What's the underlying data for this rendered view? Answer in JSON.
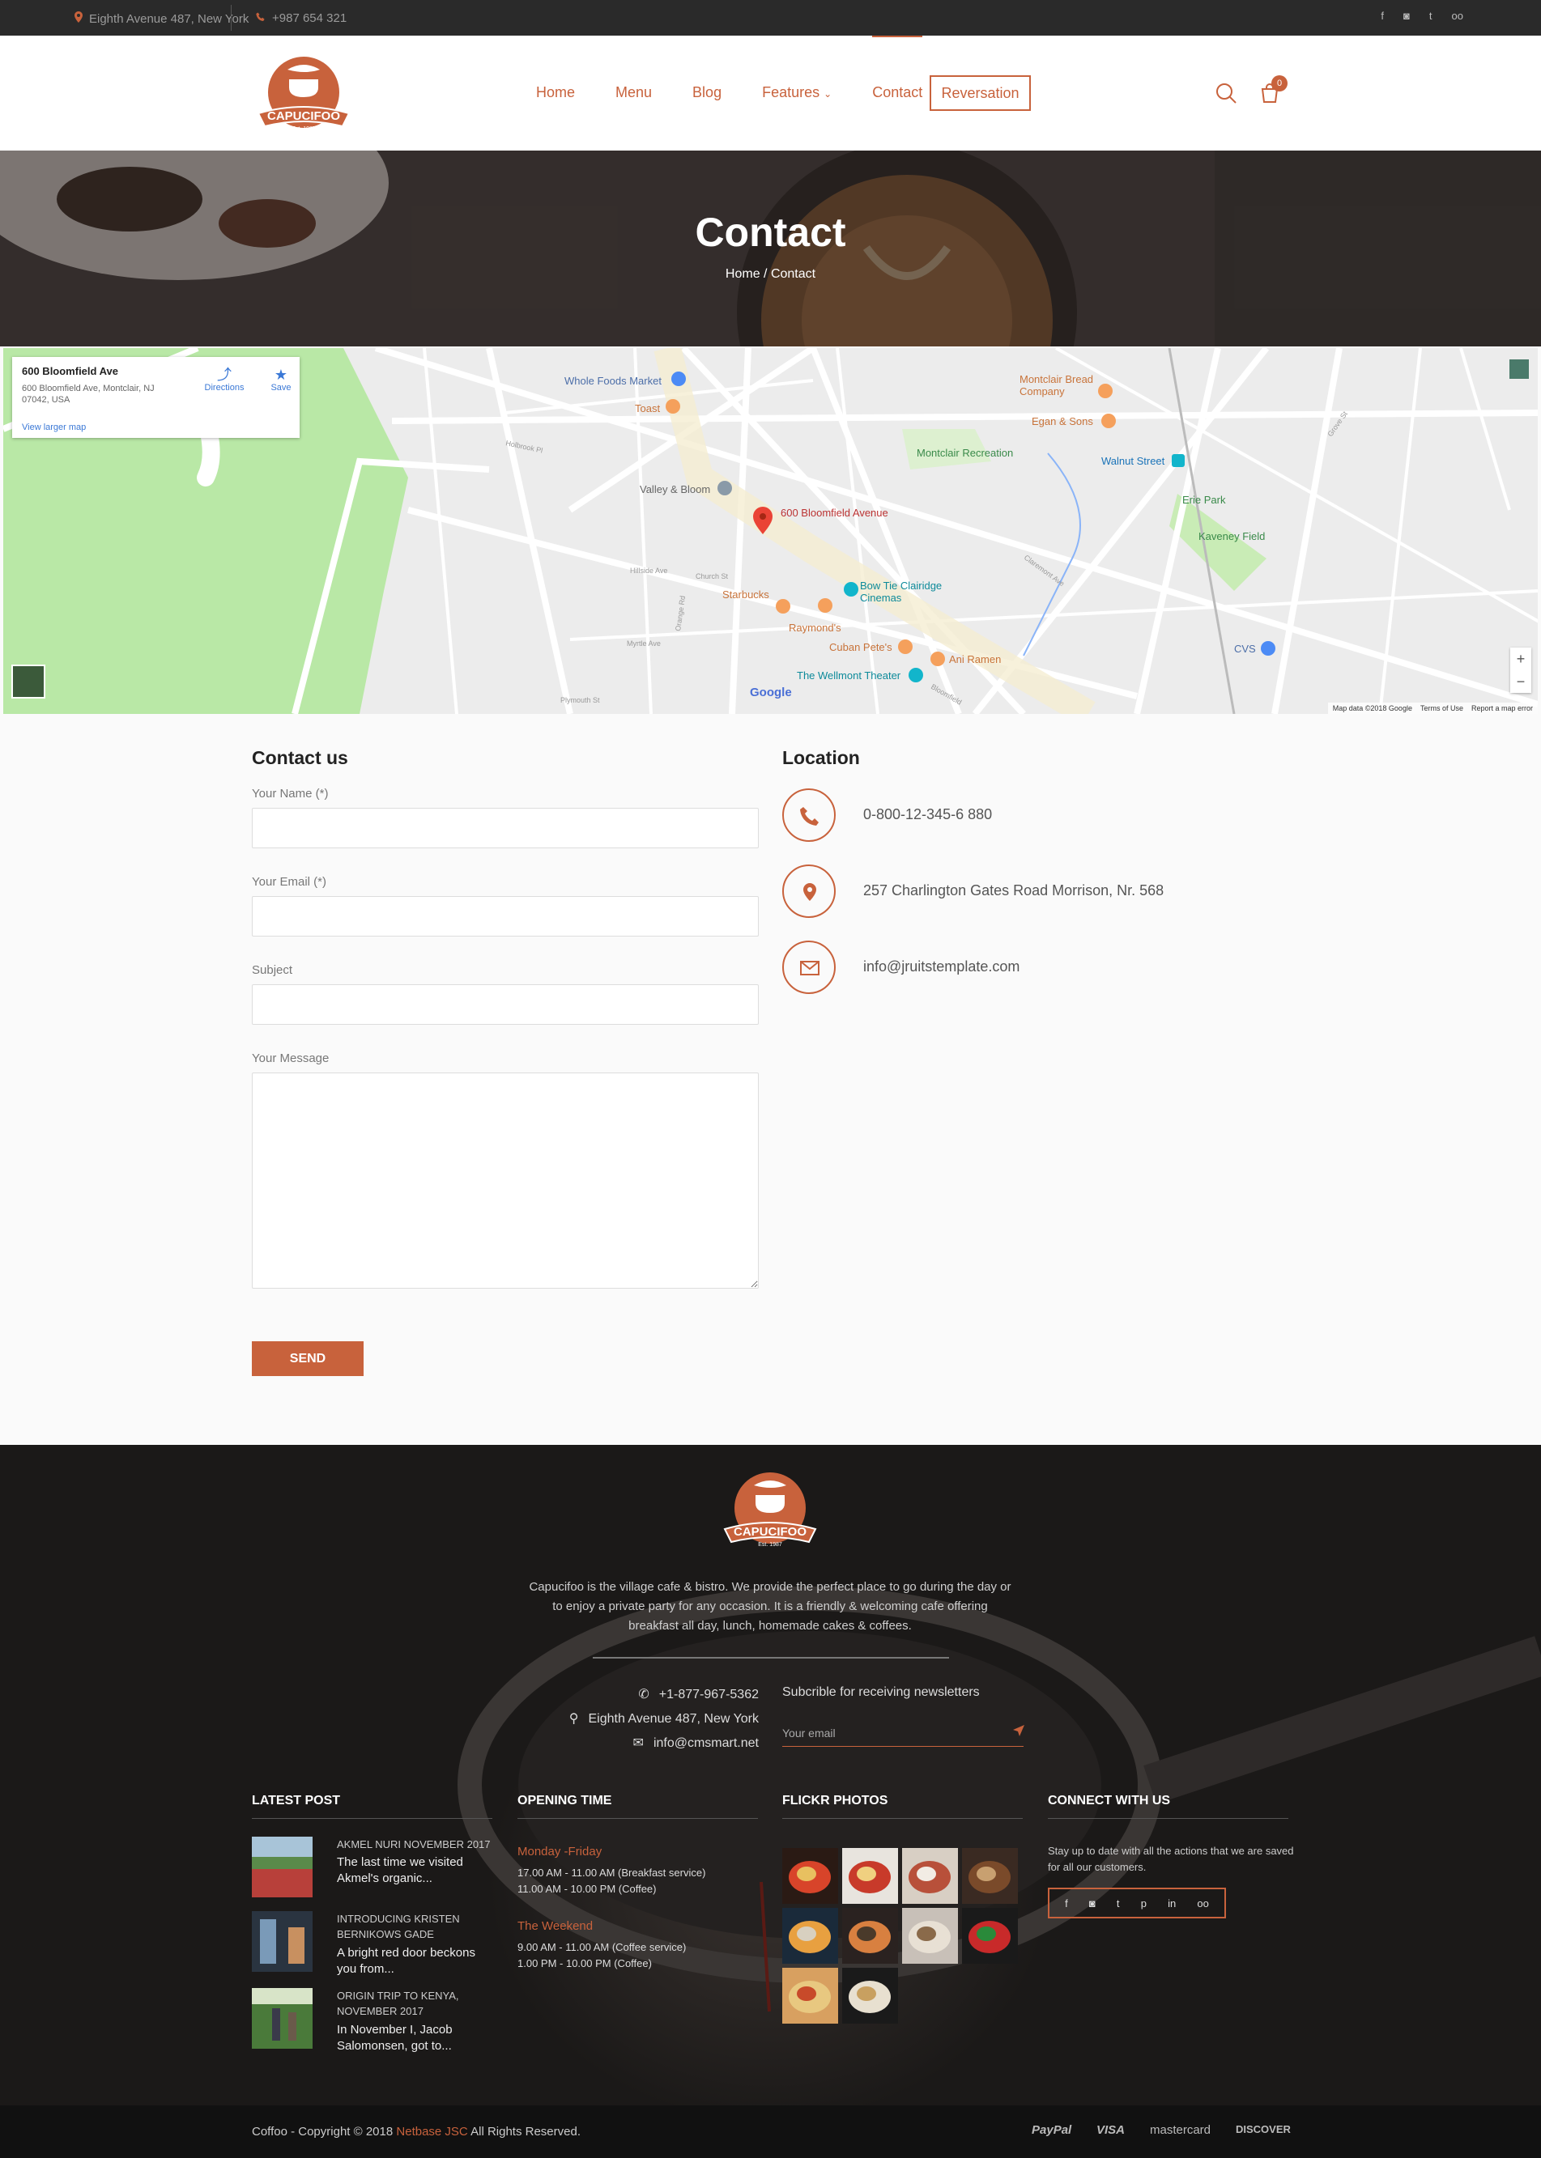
{
  "topbar": {
    "address": "Eighth Avenue 487, New York",
    "phone": "+987 654 321",
    "socials": [
      "facebook-icon",
      "instagram-icon",
      "twitter-icon",
      "tripadvisor-icon"
    ]
  },
  "header": {
    "logo_text": "CAPUCIFOO",
    "logo_sub": "Est. 1987",
    "nav": [
      "Home",
      "Menu",
      "Blog",
      "Features",
      "Contact"
    ],
    "reserve_label": "Reversation",
    "cart_count": "0"
  },
  "hero": {
    "title": "Contact",
    "breadcrumb": "Home / Contact"
  },
  "map": {
    "card_title": "600 Bloomfield Ave",
    "card_address": "600 Bloomfield Ave, Montclair, NJ 07042, USA",
    "card_link": "View larger map",
    "directions": "Directions",
    "save": "Save",
    "pin_label": "600 Bloomfield Avenue",
    "places": [
      "Whole Foods Market",
      "Toast",
      "Valley & Bloom",
      "Starbucks",
      "Raymond's",
      "Bow Tie Clairidge Cinemas",
      "Cuban Pete's",
      "Ani Ramen",
      "The Wellmont Theater",
      "Montclair Bread Company",
      "Egan & Sons",
      "Montclair Recreation",
      "Walnut Street",
      "Erie Park",
      "Kaveney Field",
      "CVS"
    ],
    "streets": [
      "Claremont Ave",
      "Grove St",
      "Orange Rd",
      "Bloomfield",
      "Hillside Ave",
      "Church St",
      "Plymouth St"
    ],
    "footer": [
      "Map data ©2018 Google",
      "Terms of Use",
      "Report a map error"
    ],
    "google": "Google"
  },
  "contact_form": {
    "title": "Contact us",
    "name_label": "Your Name (*)",
    "email_label": "Your Email (*)",
    "subject_label": "Subject",
    "message_label": "Your Message",
    "send_label": "SEND"
  },
  "location": {
    "title": "Location",
    "phone": "0-800-12-345-6 880",
    "address": "257 Charlington Gates Road Morrison, Nr. 568",
    "email": "info@jruitstemplate.com"
  },
  "footer": {
    "logo_text": "CAPUCIFOO",
    "logo_sub": "Est. 1987",
    "about": "Capucifoo is the village cafe & bistro. We provide the perfect place to go during the day or to enjoy a private party for any occasion. It is a friendly & welcoming cafe offering breakfast all day, lunch, homemade cakes & coffees.",
    "phone": "+1-877-967-5362",
    "address": "Eighth Avenue 487, New York",
    "email": "info@cmsmart.net",
    "newsletter_title": "Subcrible for receiving newsletters",
    "newsletter_placeholder": "Your email",
    "latest_post_title": "LATEST POST",
    "posts": [
      {
        "meta": "AKMEL NURI NOVEMBER 2017",
        "excerpt": "The last time we visited Akmel's organic..."
      },
      {
        "meta": "INTRODUCING KRISTEN BERNIKOWS GADE",
        "excerpt": "A bright red door beckons you from..."
      },
      {
        "meta": "ORIGIN TRIP TO KENYA, NOVEMBER 2017",
        "excerpt": "In November I, Jacob Salomonsen, got to..."
      }
    ],
    "opening_title": "OPENING TIME",
    "weekday_title": "Monday -Friday",
    "weekday_1": "17.00 AM - 11.00 AM (Breakfast service)",
    "weekday_2": "11.00 AM - 10.00 PM (Coffee)",
    "weekend_title": "The Weekend",
    "weekend_1": "9.00 AM - 11.00 AM (Coffee service)",
    "weekend_2": "1.00 PM - 10.00 PM (Coffee)",
    "flickr_title": "FLICKR PHOTOS",
    "connect_title": "CONNECT WITH US",
    "connect_text": "Stay up to date with all the actions that we are saved for all our customers.",
    "connect_socials": [
      "f",
      "◙",
      "t",
      "p",
      "in",
      "oo"
    ]
  },
  "bottombar": {
    "copy_prefix": "Coffoo - Copyright © 2018",
    "copy_brand": "Netbase JSC",
    "copy_suffix": "All Rights Reserved.",
    "payments": [
      "PayPal",
      "VISA",
      "mastercard",
      "DISCOVER"
    ]
  },
  "colors": {
    "accent": "#c8623c",
    "dark": "#2a2a2a",
    "footer": "#1b1918"
  }
}
